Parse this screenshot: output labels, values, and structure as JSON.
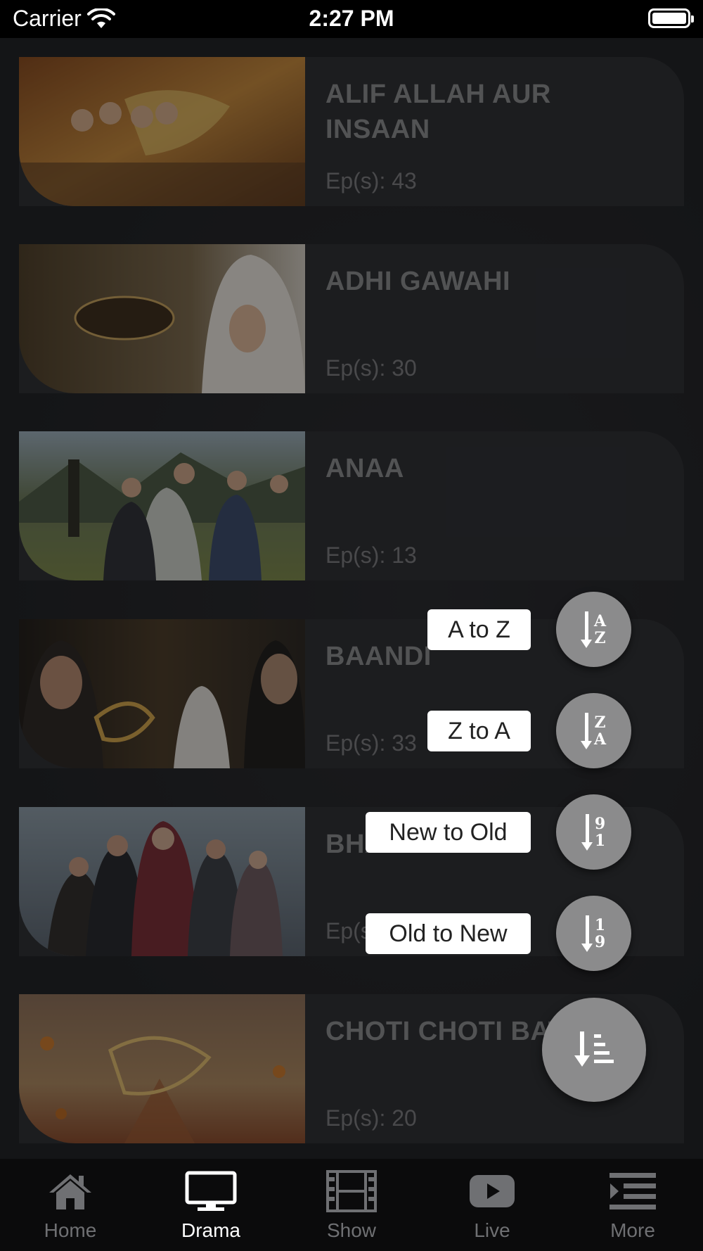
{
  "status_bar": {
    "carrier": "Carrier",
    "time": "2:27 PM"
  },
  "dramas": [
    {
      "title": "ALIF ALLAH AUR INSAAN",
      "episodes": "Ep(s): 43"
    },
    {
      "title": "ADHI GAWAHI",
      "episodes": "Ep(s): 30"
    },
    {
      "title": "ANAA",
      "episodes": "Ep(s): 13"
    },
    {
      "title": "BAANDI",
      "episodes": "Ep(s): 33"
    },
    {
      "title": "BHARAM",
      "episodes": "Ep(s): 32"
    },
    {
      "title": "CHOTI CHOTI BATAIN",
      "episodes": "Ep(s): 20"
    }
  ],
  "sort_menu": {
    "options": [
      {
        "label": "A to Z",
        "top": "A",
        "bottom": "Z"
      },
      {
        "label": "Z to A",
        "top": "Z",
        "bottom": "A"
      },
      {
        "label": "New to Old",
        "top": "9",
        "bottom": "1"
      },
      {
        "label": "Old to New",
        "top": "1",
        "bottom": "9"
      }
    ]
  },
  "tabs": [
    {
      "label": "Home",
      "icon": "home-icon",
      "active": false
    },
    {
      "label": "Drama",
      "icon": "tv-icon",
      "active": true
    },
    {
      "label": "Show",
      "icon": "film-icon",
      "active": false
    },
    {
      "label": "Live",
      "icon": "play-icon",
      "active": false
    },
    {
      "label": "More",
      "icon": "menu-icon",
      "active": false
    }
  ]
}
